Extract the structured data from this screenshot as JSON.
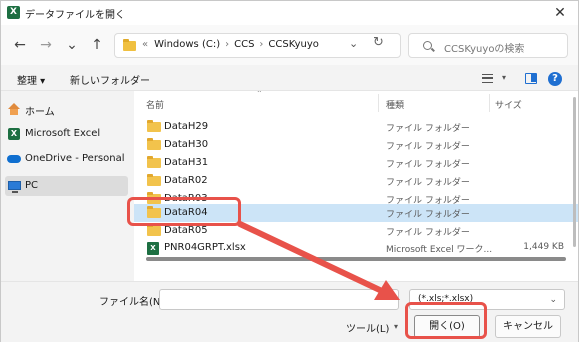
{
  "title": "データファイルを開く",
  "title_icon": "X",
  "nav": {
    "back": "←",
    "forward": "→",
    "history": "⌄",
    "up": "↑"
  },
  "address": {
    "overflow": "«",
    "crumbs": [
      "Windows (C:)",
      "CCS",
      "CCSKyuyo"
    ],
    "separator": "›",
    "dropdown": "⌄",
    "refresh": "↻"
  },
  "search": {
    "placeholder": "CCSKyuyoの検索"
  },
  "commands": {
    "organize": "整理 ▾",
    "new_folder": "新しいフォルダー",
    "view_dropdown": "▾",
    "help": "?"
  },
  "navpane": [
    {
      "label": "ホーム",
      "icon": "home-icon"
    },
    {
      "label": "Microsoft Excel",
      "icon": "excel-icon"
    },
    {
      "label": "OneDrive - Personal",
      "icon": "onedrive-icon"
    },
    {
      "label": "PC",
      "icon": "pc-icon",
      "selected": true
    }
  ],
  "columns": {
    "name": "名前",
    "type": "種類",
    "size": "サイズ",
    "sort_arrow": "⌃"
  },
  "files": [
    {
      "name": "DataH29",
      "type": "ファイル フォルダー",
      "size": "",
      "icon": "folder-icon"
    },
    {
      "name": "DataH30",
      "type": "ファイル フォルダー",
      "size": "",
      "icon": "folder-icon"
    },
    {
      "name": "DataH31",
      "type": "ファイル フォルダー",
      "size": "",
      "icon": "folder-icon"
    },
    {
      "name": "DataR02",
      "type": "ファイル フォルダー",
      "size": "",
      "icon": "folder-icon"
    },
    {
      "name": "DataR03",
      "type": "ファイル フォルダー",
      "size": "",
      "icon": "folder-icon"
    },
    {
      "name": "DataR04",
      "type": "ファイル フォルダー",
      "size": "",
      "icon": "folder-icon",
      "selected": true
    },
    {
      "name": "DataR05",
      "type": "ファイル フォルダー",
      "size": "",
      "icon": "folder-icon"
    },
    {
      "name": "PNR04GRPT.xlsx",
      "type": "Microsoft Excel ワーク...",
      "size": "1,449 KB",
      "icon": "xlsx-icon"
    }
  ],
  "bottom": {
    "filename_label": "ファイル名(N):",
    "filename_value": "",
    "filter": "(*.xls;*.xlsx)",
    "filter_dropdown": "⌄",
    "tools": "ツール(L)",
    "tools_dropdown": "▾",
    "open": "開く(O)",
    "cancel": "キャンセル"
  },
  "close": "✕",
  "annotation_color": "#e8524a",
  "accent": "#1f6fd1",
  "selection_color": "#cce4f7"
}
